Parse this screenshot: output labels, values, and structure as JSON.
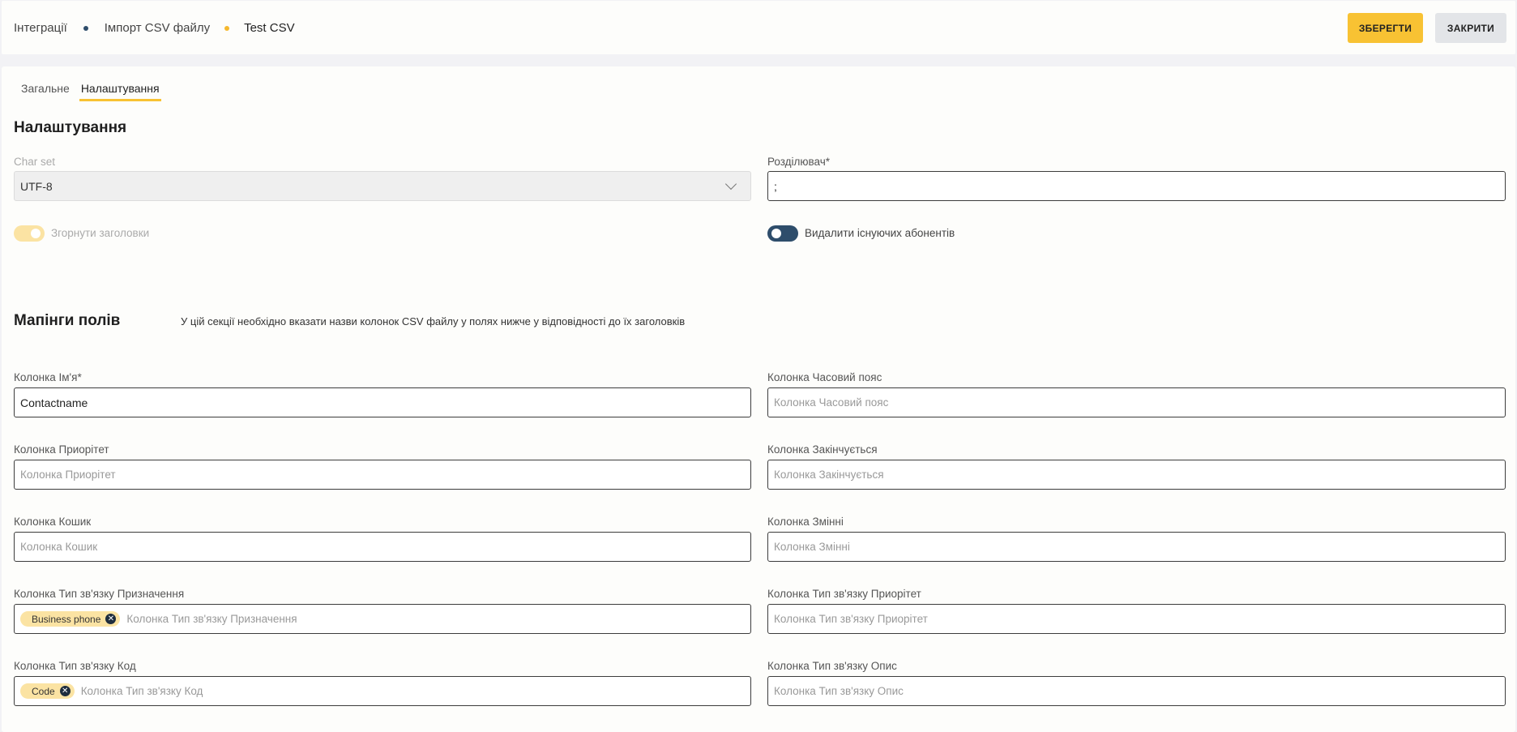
{
  "breadcrumbs": [
    "Інтеграції",
    "Імпорт CSV файлу",
    "Test CSV"
  ],
  "header_buttons": {
    "save": "ЗБЕРЕГТИ",
    "close": "ЗАКРИТИ"
  },
  "tabs": [
    {
      "label": "Загальне",
      "active": false
    },
    {
      "label": "Налаштування",
      "active": true
    }
  ],
  "settings": {
    "title": "Налаштування",
    "charset": {
      "label": "Char set",
      "value": "UTF-8",
      "disabled": true
    },
    "delimiter": {
      "label": "Розділювач*",
      "value": ";"
    },
    "collapse_headers": {
      "label": "Згорнути заголовки",
      "on": false,
      "disabled": true
    },
    "delete_subscribers": {
      "label": "Видалити існуючих абонентів",
      "on": false
    }
  },
  "mapping": {
    "title": "Мапінги полів",
    "description": "У цій секції необхідно вказати назви колонок CSV файлу у полях нижче у відповідності до їх заголовків",
    "fields": {
      "name": {
        "label": "Колонка Ім'я*",
        "value": "Contactname",
        "placeholder": ""
      },
      "timezone": {
        "label": "Колонка Часовий пояс",
        "value": "",
        "placeholder": "Колонка Часовий пояс"
      },
      "priority": {
        "label": "Колонка Приорітет",
        "value": "",
        "placeholder": "Колонка Приорітет"
      },
      "expires": {
        "label": "Колонка Закінчується",
        "value": "",
        "placeholder": "Колонка Закінчується"
      },
      "bucket": {
        "label": "Колонка Кошик",
        "value": "",
        "placeholder": "Колонка Кошик"
      },
      "variables": {
        "label": "Колонка Змінні",
        "value": "",
        "placeholder": "Колонка Змінні"
      },
      "comm_destination": {
        "label": "Колонка Тип зв'язку Призначення",
        "chip": "Business phone",
        "placeholder": "Колонка  Тип зв'язку Призначення"
      },
      "comm_priority": {
        "label": "Колонка Тип зв'язку Приорітет",
        "value": "",
        "placeholder": "Колонка  Тип зв'язку Приорітет"
      },
      "comm_code": {
        "label": "Колонка Тип зв'язку Код",
        "chip": "Code",
        "placeholder": "Колонка  Тип зв'язку Код"
      },
      "comm_description": {
        "label": "Колонка Тип зв'язку Опис",
        "value": "",
        "placeholder": "Колонка  Тип зв'язку Опис"
      }
    }
  },
  "colors": {
    "accent": "#f8c233",
    "dark": "#2e4d6b"
  }
}
